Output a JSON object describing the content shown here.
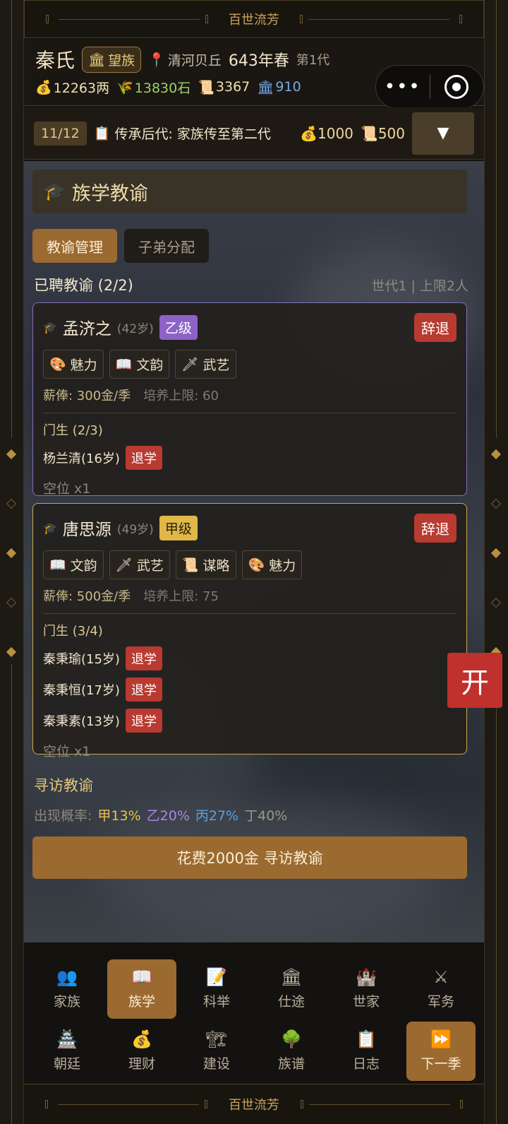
{
  "app": {
    "title": "百世流芳"
  },
  "header": {
    "clan_name": "秦氏",
    "rank": "望族",
    "rank_icon": "🏛",
    "location": "清河贝丘",
    "year": "643年春",
    "generation": "第1代",
    "resources": {
      "money": "12263两",
      "grain": "13830石",
      "scrolls": "3367",
      "fame": "910"
    }
  },
  "mini_program": {
    "menu_glyph": "•••"
  },
  "quest": {
    "count": "11/12",
    "text": "传承后代: 家族传至第二代",
    "reward_money": "1000",
    "reward_scroll": "500",
    "toggle": "▼"
  },
  "section": {
    "title": "族学教谕"
  },
  "tabs": [
    {
      "label": "教谕管理"
    },
    {
      "label": "子弟分配"
    }
  ],
  "hired": {
    "label": "已聘教谕 (2/2)",
    "limit": "世代1 | 上限2人"
  },
  "teachers": [
    {
      "name": "孟济之",
      "age": "(42岁)",
      "grade": "乙级",
      "dismiss": "辞退",
      "skills": [
        {
          "icon": "🎨",
          "label": "魅力"
        },
        {
          "icon": "📖",
          "label": "文韵"
        },
        {
          "icon": "🗡",
          "label": "武艺"
        }
      ],
      "salary": "薪俸: 300金/季",
      "cap": "培养上限: 60",
      "students_title": "门生 (2/3)",
      "students": [
        {
          "name": "杨兰清(16岁)",
          "action": "退学"
        }
      ],
      "empty": "空位 x1"
    },
    {
      "name": "唐思源",
      "age": "(49岁)",
      "grade": "甲级",
      "dismiss": "辞退",
      "skills": [
        {
          "icon": "📖",
          "label": "文韵"
        },
        {
          "icon": "🗡",
          "label": "武艺"
        },
        {
          "icon": "📜",
          "label": "谋略"
        },
        {
          "icon": "🎨",
          "label": "魅力"
        }
      ],
      "salary": "薪俸: 500金/季",
      "cap": "培养上限: 75",
      "students_title": "门生 (3/4)",
      "students": [
        {
          "name": "秦秉瑜(15岁)",
          "action": "退学"
        },
        {
          "name": "秦秉恒(17岁)",
          "action": "退学"
        },
        {
          "name": "秦秉素(13岁)",
          "action": "退学"
        }
      ],
      "empty": "空位 x1"
    }
  ],
  "search": {
    "title": "寻访教谕",
    "rate_label": "出现概率:",
    "rate_a": "甲13%",
    "rate_b": "乙20%",
    "rate_c": "丙27%",
    "rate_d": "丁40%",
    "button": "花费2000金 寻访教谕"
  },
  "float_button": "开",
  "nav": [
    {
      "icon": "👥",
      "label": "家族"
    },
    {
      "icon": "📖",
      "label": "族学"
    },
    {
      "icon": "📝",
      "label": "科举"
    },
    {
      "icon": "🏛",
      "label": "仕途"
    },
    {
      "icon": "🏰",
      "label": "世家"
    },
    {
      "icon": "⚔",
      "label": "军务"
    },
    {
      "icon": "🏯",
      "label": "朝廷"
    },
    {
      "icon": "💰",
      "label": "理财"
    },
    {
      "icon": "🏗",
      "label": "建设"
    },
    {
      "icon": "🌳",
      "label": "族谱"
    },
    {
      "icon": "📋",
      "label": "日志"
    },
    {
      "icon": "⏩",
      "label": "下一季"
    }
  ],
  "colors": {
    "accent": "#9a6a30",
    "danger": "#b83a30",
    "grade_b": "#8c62c6",
    "grade_a": "#e0b848"
  }
}
